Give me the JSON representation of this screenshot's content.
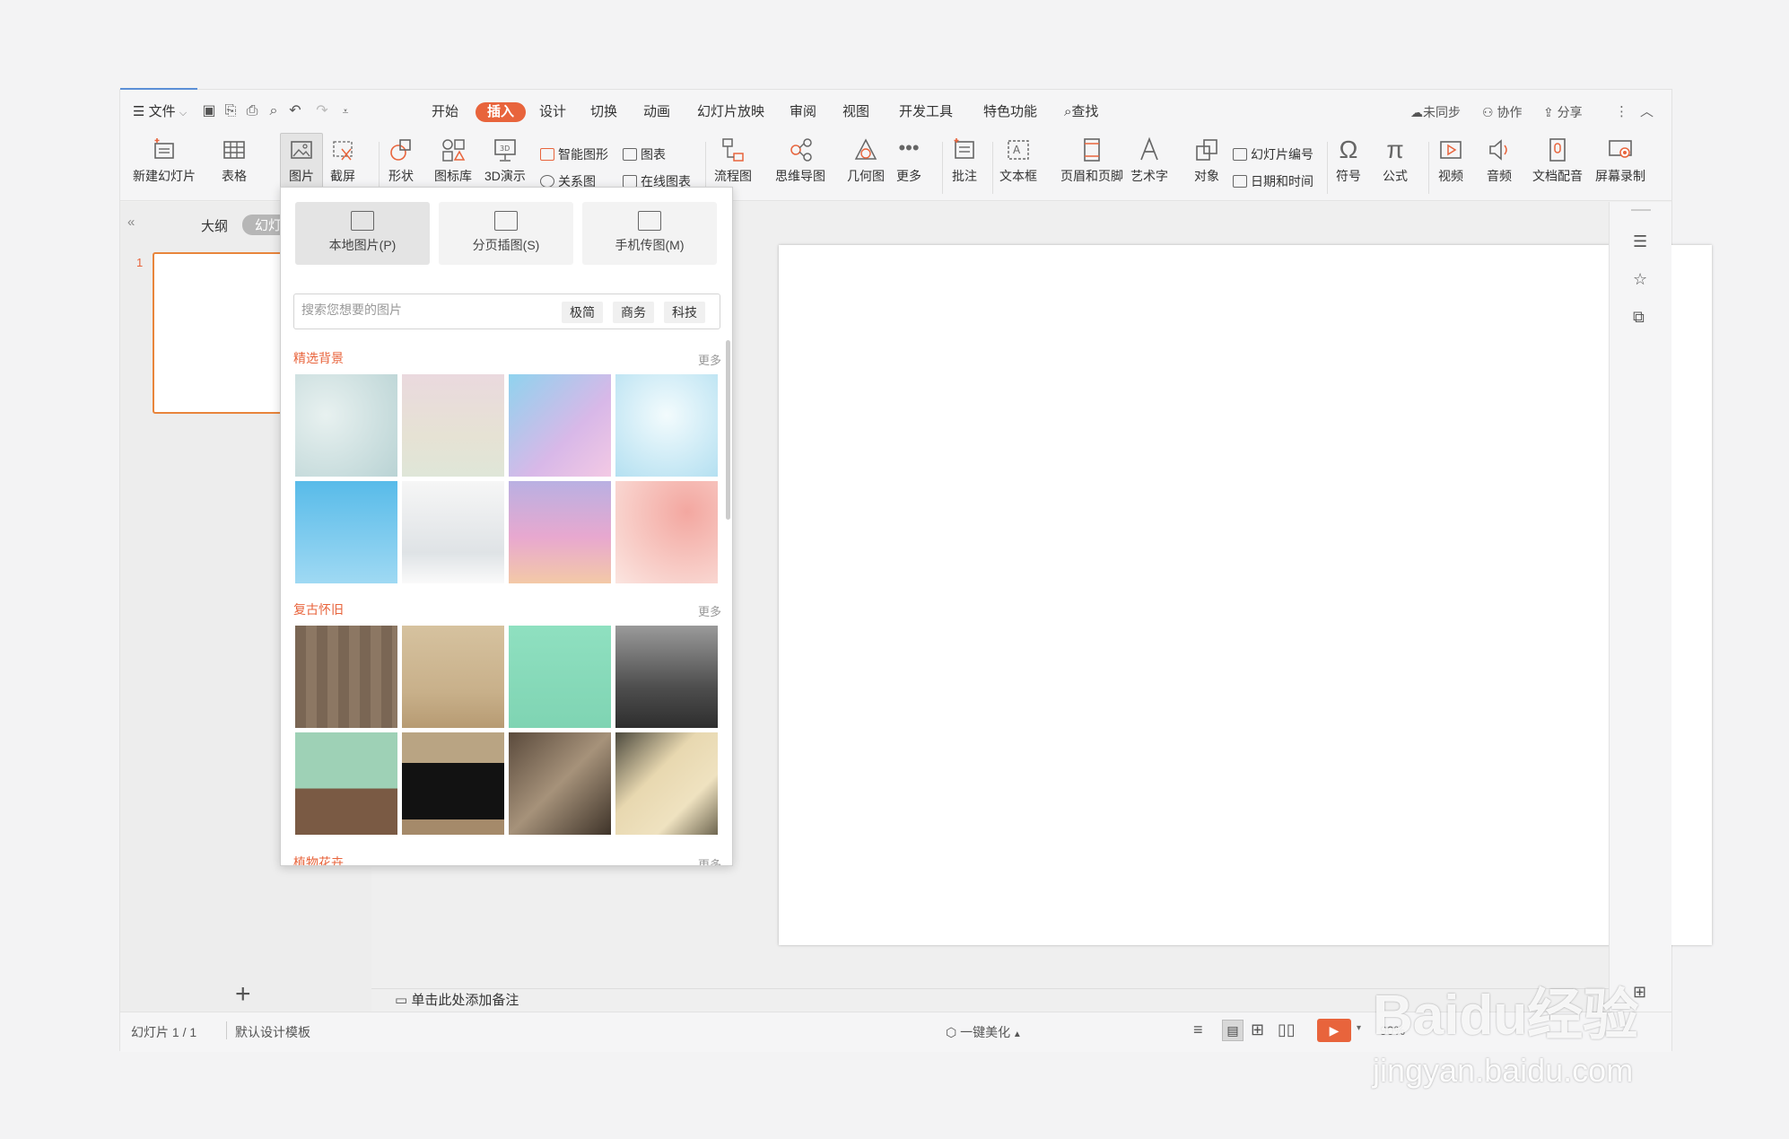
{
  "menubar": {
    "file": "文件",
    "tabs": [
      "开始",
      "插入",
      "设计",
      "切换",
      "动画",
      "幻灯片放映",
      "审阅",
      "视图",
      "开发工具",
      "特色功能"
    ],
    "active_tab": "插入",
    "search": "查找",
    "unsync": "未同步",
    "collab": "协作",
    "share": "分享"
  },
  "ribbon": {
    "new_slide": "新建幻灯片",
    "table": "表格",
    "picture": "图片",
    "screenshot": "截屏",
    "shape": "形状",
    "icon_lib": "图标库",
    "demo3d": "3D演示",
    "smart_shape": "智能图形",
    "chart": "图表",
    "relation": "关系图",
    "online_chart": "在线图表",
    "flowchart": "流程图",
    "mindmap": "思维导图",
    "geometry": "几何图",
    "more": "更多",
    "comment": "批注",
    "textbox": "文本框",
    "header_footer": "页眉和页脚",
    "wordart": "艺术字",
    "object": "对象",
    "slide_number": "幻灯片编号",
    "datetime": "日期和时间",
    "symbol": "符号",
    "formula": "公式",
    "video": "视频",
    "audio": "音频",
    "doc_voice": "文档配音",
    "screen_record": "屏幕录制"
  },
  "left_panel": {
    "outline_tab": "大纲",
    "slides_tab": "幻灯片",
    "slide_index": "1",
    "add": "+"
  },
  "notes": "单击此处添加备注",
  "status": {
    "slide_count": "幻灯片 1 / 1",
    "template": "默认设计模板",
    "beautify": "一键美化",
    "zoom": "90%"
  },
  "dropdown": {
    "local_picture": "本地图片(P)",
    "paged_picture": "分页插图(S)",
    "phone_picture": "手机传图(M)",
    "search_placeholder": "搜索您想要的图片",
    "tags": [
      "极简",
      "商务",
      "科技"
    ],
    "section1_title": "精选背景",
    "section2_title": "复古怀旧",
    "section3_title": "植物花卉",
    "more": "更多"
  },
  "colors": {
    "accent": "#e8643c",
    "selected_thumb_border": "#e8853c"
  },
  "watermark": {
    "brand": "Baidu经验",
    "url": "jingyan.baidu.com"
  }
}
